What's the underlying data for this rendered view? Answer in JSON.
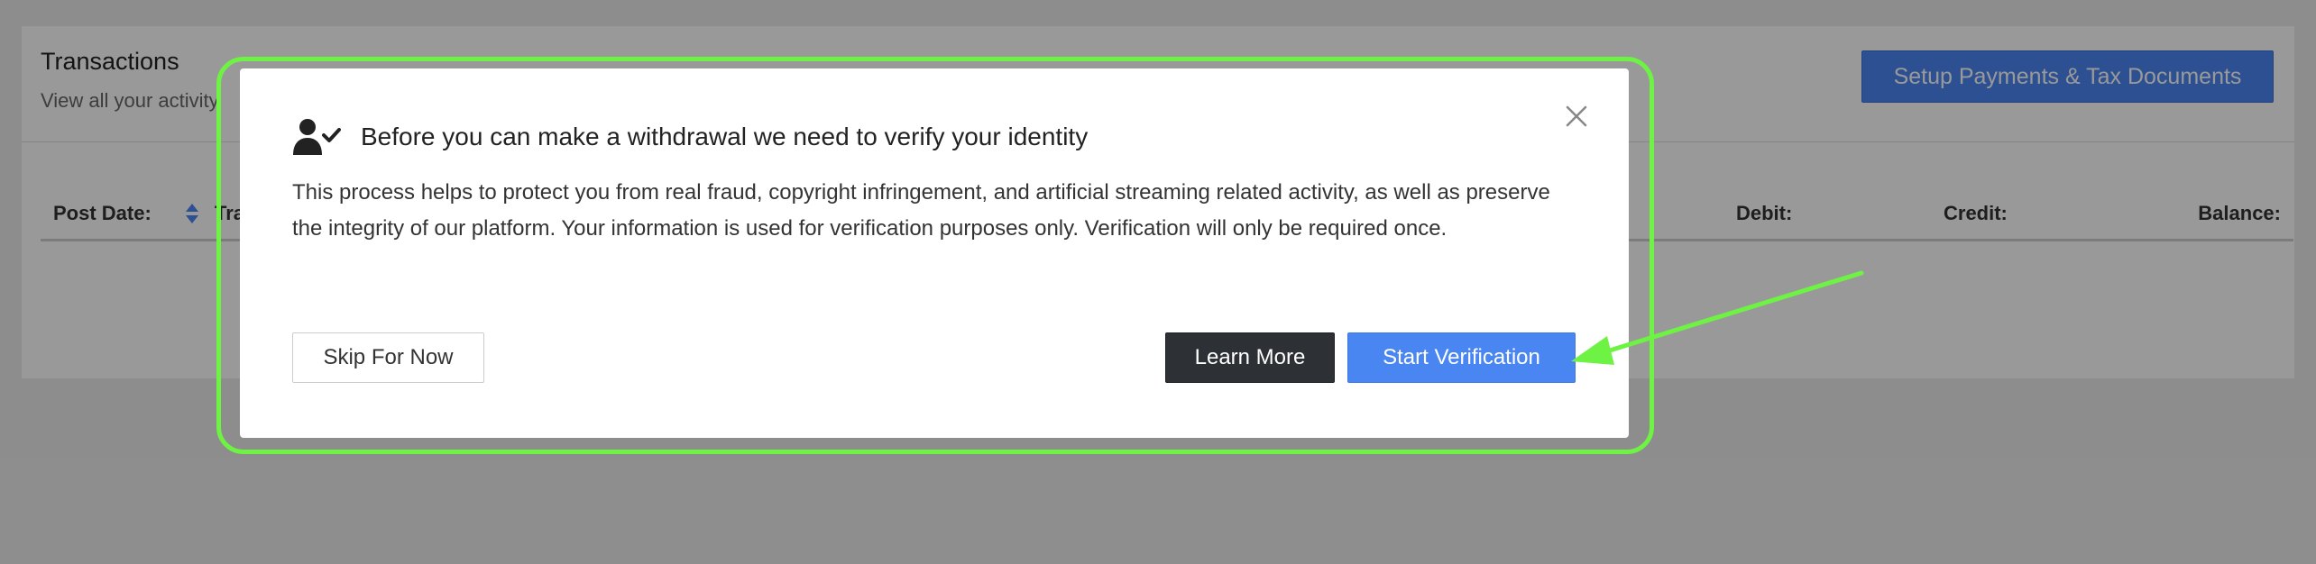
{
  "page": {
    "title": "Transactions",
    "subtitle": "View all your activity",
    "setup_button_label": "Setup Payments & Tax Documents",
    "table_headers": {
      "post_date": "Post Date:",
      "type": "Transaction Type:",
      "debit": "Debit:",
      "credit": "Credit:",
      "balance": "Balance:"
    }
  },
  "modal": {
    "title": "Before you can make a withdrawal we need to verify your identity",
    "body": "This process helps to protect you from real fraud, copyright infringement, and artificial streaming related activity, as well as preserve the integrity of our platform. Your information is used for verification purposes only. Verification will only be required once.",
    "skip_label": "Skip For Now",
    "learn_more_label": "Learn More",
    "start_label": "Start Verification",
    "icons": {
      "title_icon": "user-check-icon",
      "close_icon": "close-icon"
    }
  },
  "colors": {
    "primary_blue": "#4a86f2",
    "dark_button": "#2d3034",
    "annotation_green": "#6ef244",
    "overlay": "rgba(0,0,0,0.4)"
  }
}
